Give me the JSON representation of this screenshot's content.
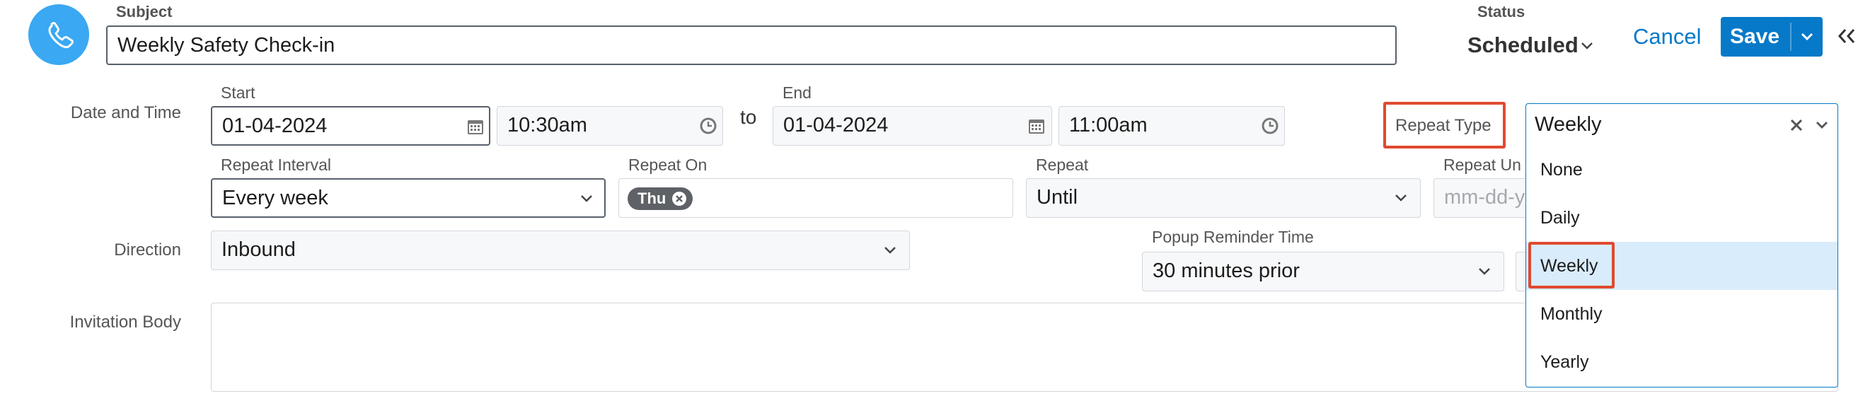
{
  "subject": {
    "label": "Subject",
    "value": "Weekly Safety Check-in"
  },
  "status": {
    "label": "Status",
    "value": "Scheduled"
  },
  "actions": {
    "cancel": "Cancel",
    "save": "Save"
  },
  "datetime": {
    "row_label": "Date and Time",
    "start_label": "Start",
    "start_date": "01-04-2024",
    "start_time": "10:30am",
    "to": "to",
    "end_label": "End",
    "end_date": "01-04-2024",
    "end_time": "11:00am"
  },
  "repeat_type": {
    "label": "Repeat Type",
    "value": "Weekly",
    "options": [
      "None",
      "Daily",
      "Weekly",
      "Monthly",
      "Yearly"
    ],
    "highlighted_index": 2
  },
  "repeat_interval": {
    "label": "Repeat Interval",
    "value": "Every week"
  },
  "repeat_on": {
    "label": "Repeat On",
    "chip": "Thu"
  },
  "repeat": {
    "label": "Repeat",
    "value": "Until"
  },
  "repeat_until": {
    "label": "Repeat Un",
    "placeholder": "mm-dd-y"
  },
  "direction": {
    "label": "Direction",
    "value": "Inbound"
  },
  "popup_reminder": {
    "label": "Popup Reminder Time",
    "value": "30 minutes prior"
  },
  "invitation": {
    "label": "Invitation Body",
    "value": ""
  },
  "colors": {
    "brand_blue": "#0679c8",
    "avatar_blue": "#3aa8f2",
    "highlight": "#e04a2f",
    "selected_row": "#d9ecfb"
  }
}
